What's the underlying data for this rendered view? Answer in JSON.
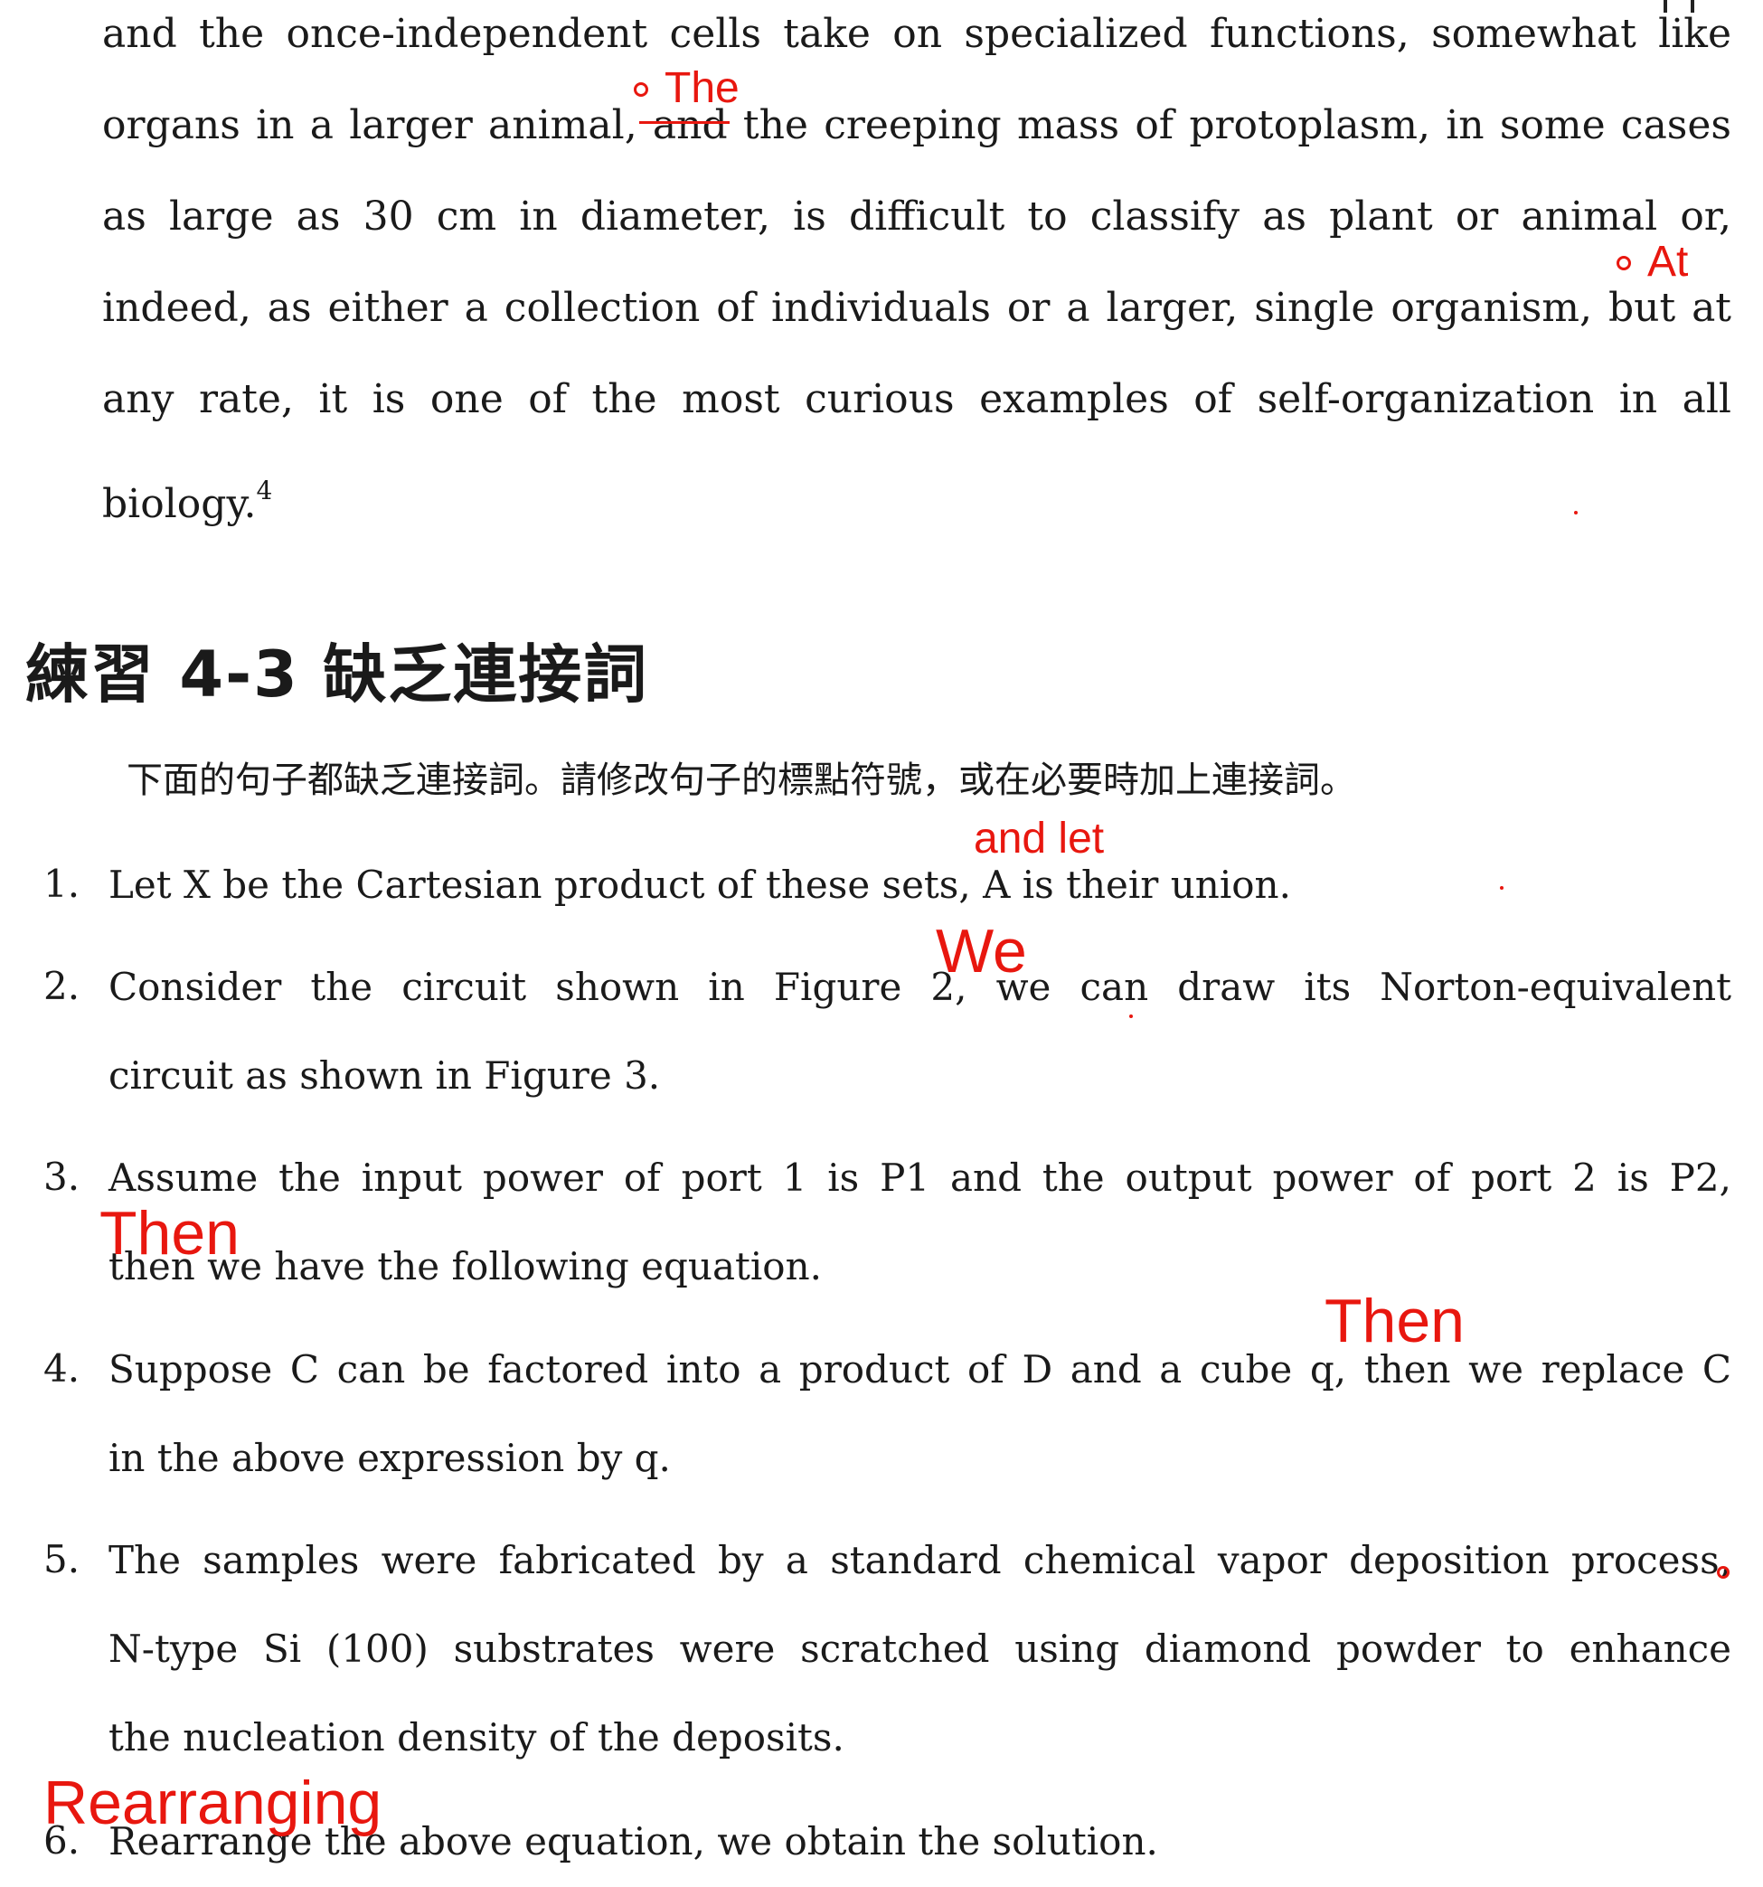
{
  "paragraph": {
    "lines": [
      "and the once-independent cells take on specialized functions, somewhat like",
      "organs in a larger animal, and the creeping mass of protoplasm, in some cases",
      "as large as 30 cm in diameter, is difficult to classify as plant or animal or,",
      "indeed, as either a collection of individuals or a larger, single organism, but at",
      "any rate, it is one of the most curious examples of self-organization in all",
      "biology."
    ],
    "footnote_ref": "4"
  },
  "exercise": {
    "heading": "練習 4-3 缺乏連接詞",
    "instruction": "下面的句子都缺乏連接詞。請修改句子的標點符號，或在必要時加上連接詞。",
    "items": [
      {
        "number": "1.",
        "lines": [
          "Let X be the Cartesian product of these sets, A is their union."
        ]
      },
      {
        "number": "2.",
        "lines": [
          "Consider the circuit shown in Figure 2, we can draw its Norton-equivalent",
          "circuit as shown in Figure 3."
        ]
      },
      {
        "number": "3.",
        "lines": [
          "Assume the input power of port 1 is P1 and the output power of port 2 is P2,",
          "then we have the following equation."
        ]
      },
      {
        "number": "4.",
        "lines": [
          "Suppose C can be factored into a product of D and a cube q, then we replace C",
          "in the above expression by q."
        ]
      },
      {
        "number": "5.",
        "lines": [
          "The samples were fabricated by a standard chemical vapor deposition process,",
          "N-type Si (100) substrates were scratched using diamond powder to enhance",
          "the nucleation density of the deposits."
        ]
      },
      {
        "number": "6.",
        "lines": [
          "Rearrange the above equation, we obtain the solution."
        ]
      }
    ]
  },
  "annotations": {
    "the": "The",
    "at": "At",
    "and_let": "and let",
    "we": "We",
    "then_3": "Then",
    "then_4": "Then",
    "rearranging": "Rearranging"
  },
  "colors": {
    "ink": "#1a1a1a",
    "correction": "#e8170f",
    "background": "#ffffff"
  }
}
